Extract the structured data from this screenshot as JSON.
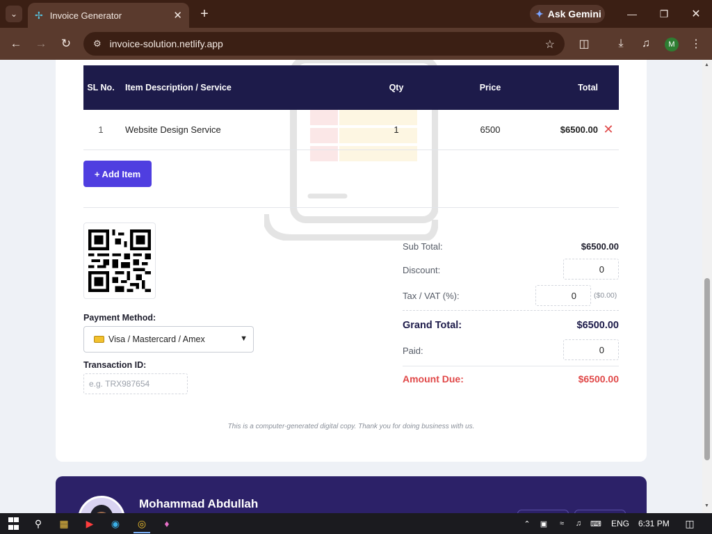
{
  "browser": {
    "tab_title": "Invoice Generator",
    "tab_favicon": "invoice-favicon",
    "gemini_label": "Ask Gemini",
    "url": "invoice-solution.netlify.app",
    "profile_initial": "M",
    "theme_colors": {
      "frame": "#3b1f14",
      "toolbar": "#5a3a2d"
    }
  },
  "table": {
    "headers": {
      "sl": "SL No.",
      "description": "Item Description / Service",
      "qty": "Qty",
      "price": "Price",
      "total": "Total"
    },
    "rows": [
      {
        "sl": "1",
        "description": "Website Design Service",
        "qty": "1",
        "price": "6500",
        "total": "$6500.00"
      }
    ]
  },
  "add_item_label": "+ Add Item",
  "payment": {
    "method_label": "Payment Method:",
    "method_value": "Visa / Mastercard / Amex",
    "transaction_label": "Transaction ID:",
    "transaction_placeholder": "e.g.  TRX987654"
  },
  "summary": {
    "subtotal_label": "Sub Total:",
    "subtotal_value": "$6500.00",
    "discount_label": "Discount:",
    "discount_value": "0",
    "tax_label": "Tax / VAT (%):",
    "tax_value": "0",
    "tax_amount": "($0.00)",
    "grand_total_label": "Grand Total:",
    "grand_total_value": "$6500.00",
    "paid_label": "Paid:",
    "paid_value": "0",
    "amount_due_label": "Amount Due:",
    "amount_due_value": "$6500.00"
  },
  "footer_note": "This is a computer-generated digital copy. Thank you for doing business with us.",
  "profile_card": {
    "name": "Mohammad Abdullah"
  },
  "taskbar": {
    "language": "ENG",
    "time": "6:31 PM"
  },
  "colors": {
    "header_navy": "#1d1b4a",
    "accent_button": "#4f3ee0",
    "danger": "#e04848",
    "profile_card_bg": "#2c2168"
  }
}
